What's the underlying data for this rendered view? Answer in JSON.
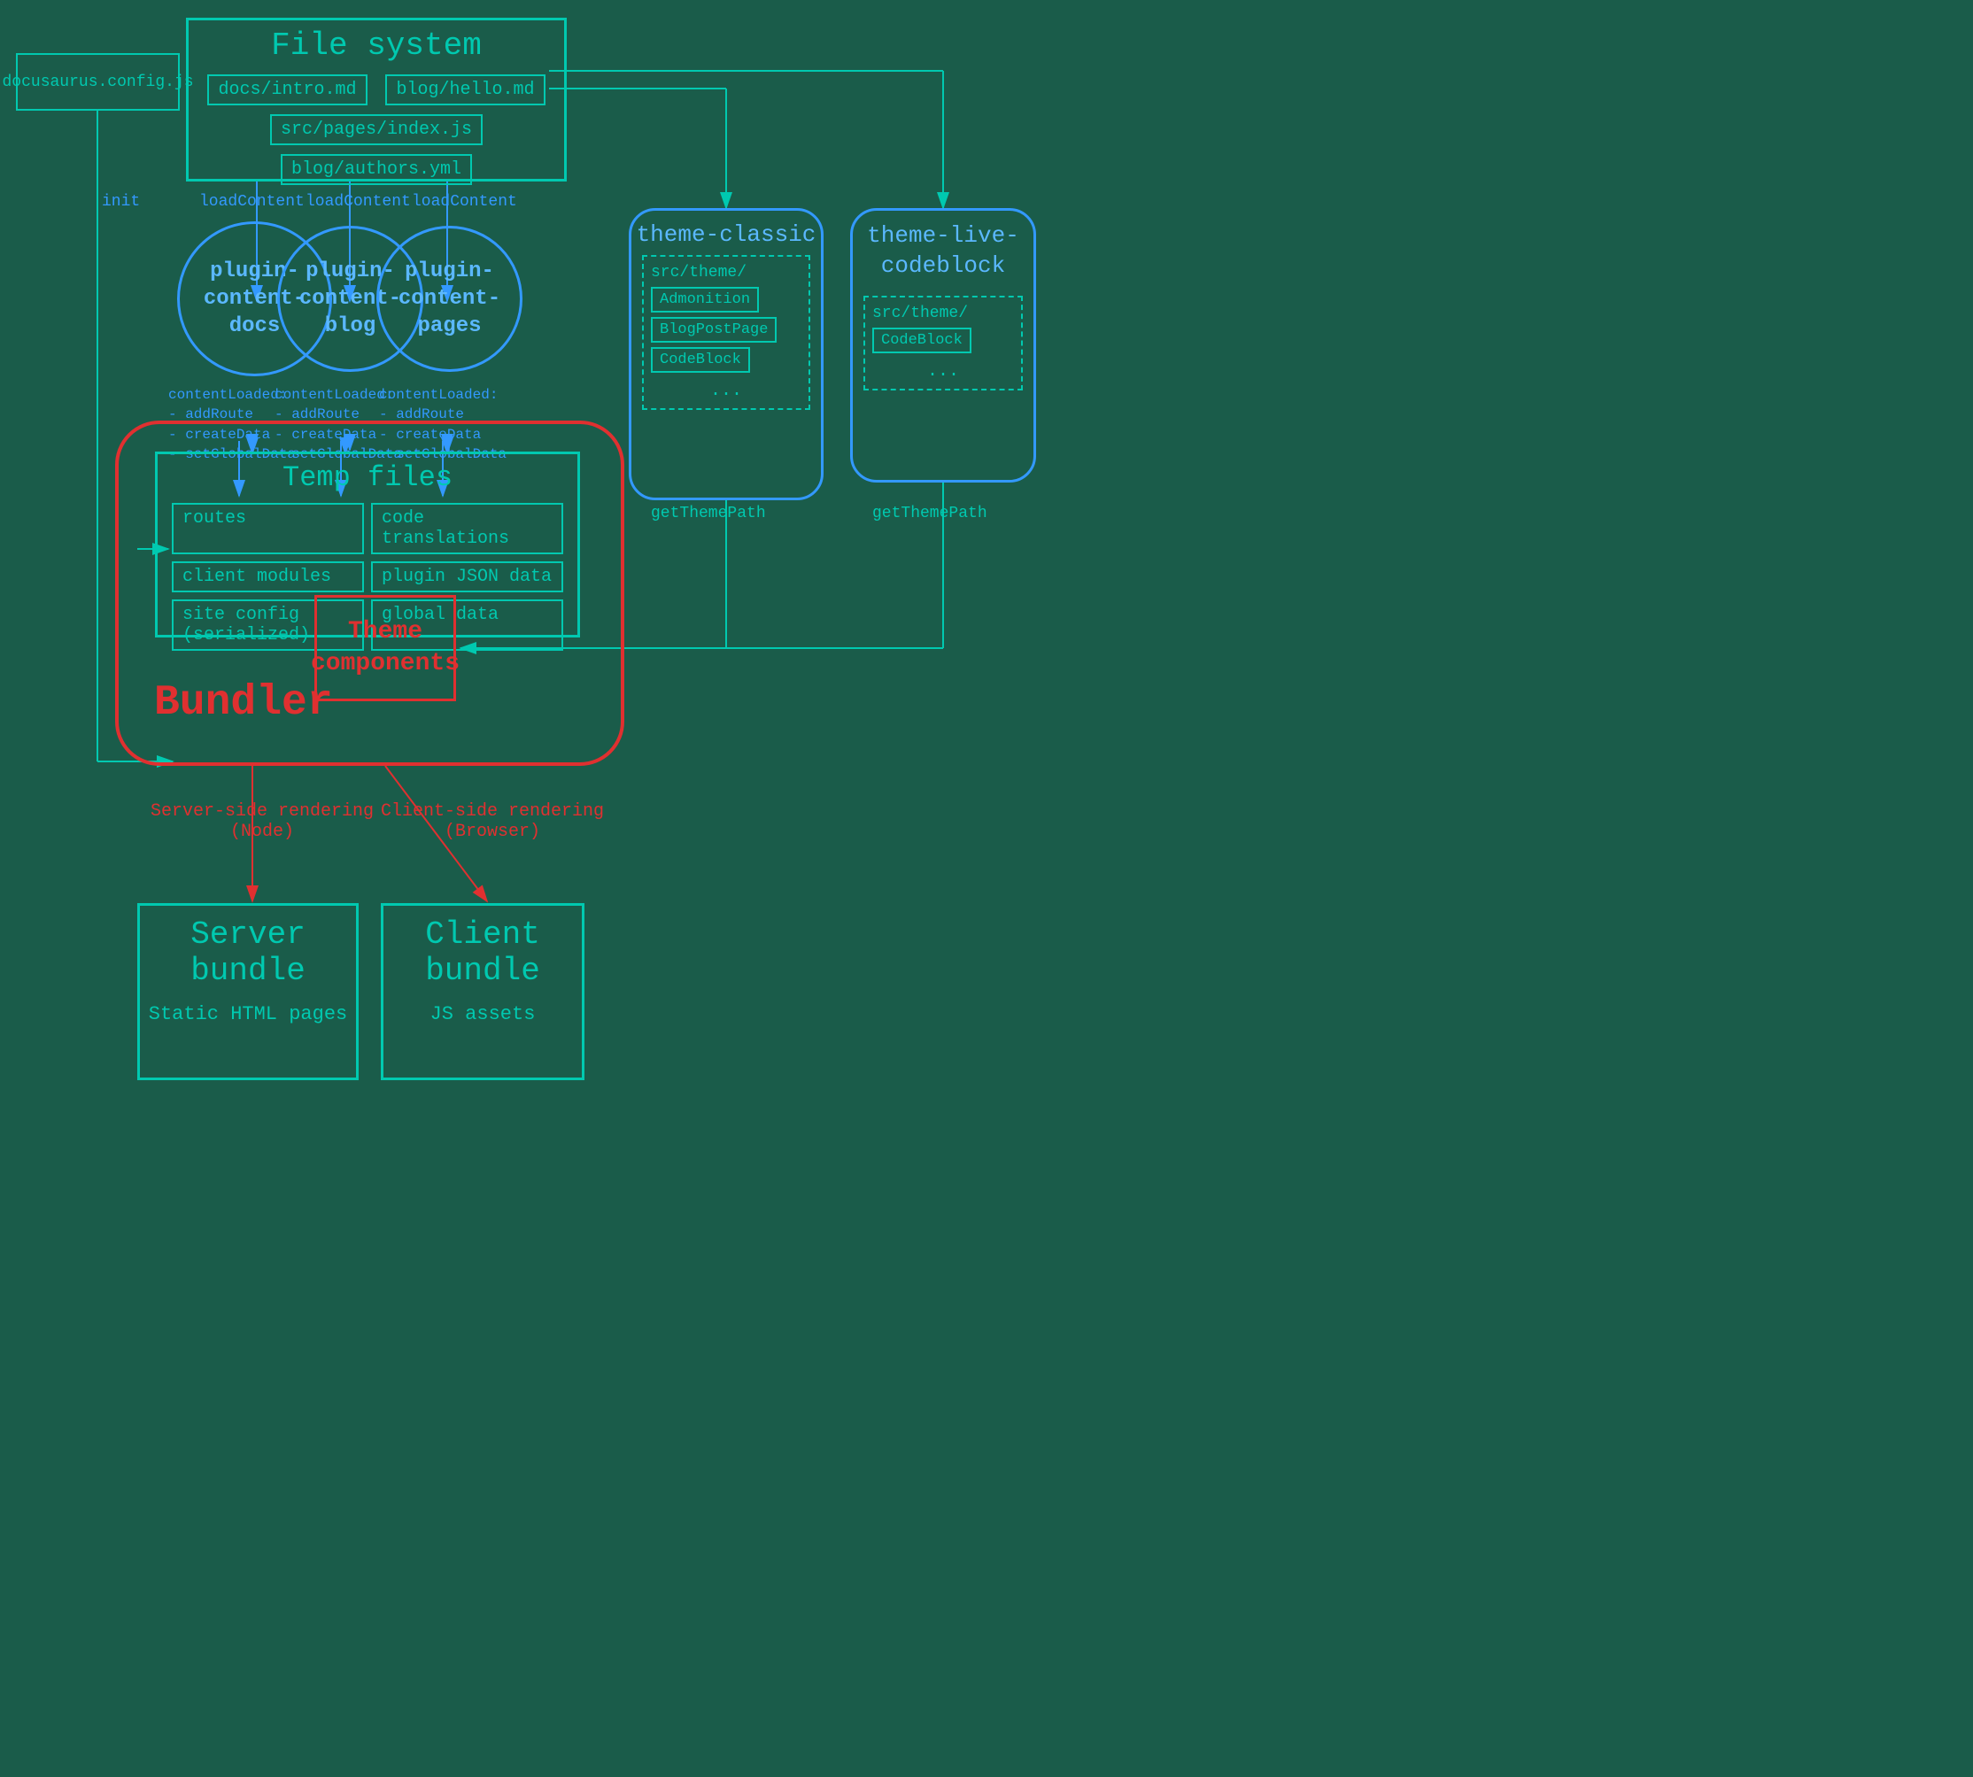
{
  "background_color": "#1a5c4a",
  "file_system": {
    "title": "File system",
    "files": [
      "docs/intro.md",
      "blog/hello.md",
      "src/pages/index.js",
      "blog/authors.yml"
    ]
  },
  "config": {
    "label": "docusaurus.config.js"
  },
  "plugins": [
    {
      "id": "plugin-content-docs",
      "label": "plugin-\ncontent-\ndocs"
    },
    {
      "id": "plugin-content-blog",
      "label": "plugin-\ncontent-\nblog"
    },
    {
      "id": "plugin-content-pages",
      "label": "plugin-\ncontent-\npages"
    }
  ],
  "theme_classic": {
    "title": "theme-classic",
    "src_path": "src/theme/",
    "components": [
      "Admonition",
      "BlogPostPage",
      "CodeBlock",
      "..."
    ]
  },
  "theme_live_codeblock": {
    "title": "theme-live-\ncodeblock",
    "src_path": "src/theme/",
    "components": [
      "CodeBlock",
      "..."
    ]
  },
  "temp_files": {
    "title": "Temp files",
    "items": [
      "routes",
      "code translations",
      "client modules",
      "plugin JSON data",
      "site config (serialized)",
      "global data"
    ]
  },
  "bundler": {
    "label": "Bundler"
  },
  "theme_components": {
    "label": "Theme\ncomponents"
  },
  "server_bundle": {
    "title": "Server bundle",
    "subtitle": "Static HTML pages"
  },
  "client_bundle": {
    "title": "Client bundle",
    "subtitle": "JS assets"
  },
  "arrows": {
    "init": "init",
    "loadContent": "loadContent",
    "contentLoaded_docs": "contentLoaded:\n- addRoute\n- createData\n- setGlobalData",
    "contentLoaded_blog": "contentLoaded:\n- addRoute\n- createData\n- setGlobalData",
    "contentLoaded_pages": "contentLoaded:\n- addRoute\n- createData\n- setGlobalData",
    "getThemePath": "getThemePath",
    "server_side": "Server-side rendering\n(Node)",
    "client_side": "Client-side rendering\n(Browser)"
  }
}
